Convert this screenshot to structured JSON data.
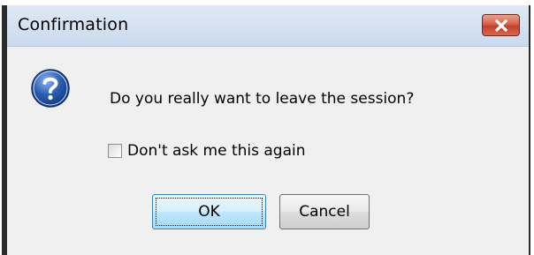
{
  "window": {
    "title": "Confirmation",
    "close_icon": "close-icon"
  },
  "dialog": {
    "icon": "question-icon",
    "message": "Do you really want to leave the session?",
    "checkbox": {
      "label": "Don't ask me this again",
      "checked": false
    },
    "buttons": {
      "ok_label": "OK",
      "cancel_label": "Cancel"
    }
  },
  "colors": {
    "titlebar": "#cbdaee",
    "close_button": "#c2412a",
    "ok_border": "#3c7fb1",
    "icon_blue": "#2a5db0"
  }
}
